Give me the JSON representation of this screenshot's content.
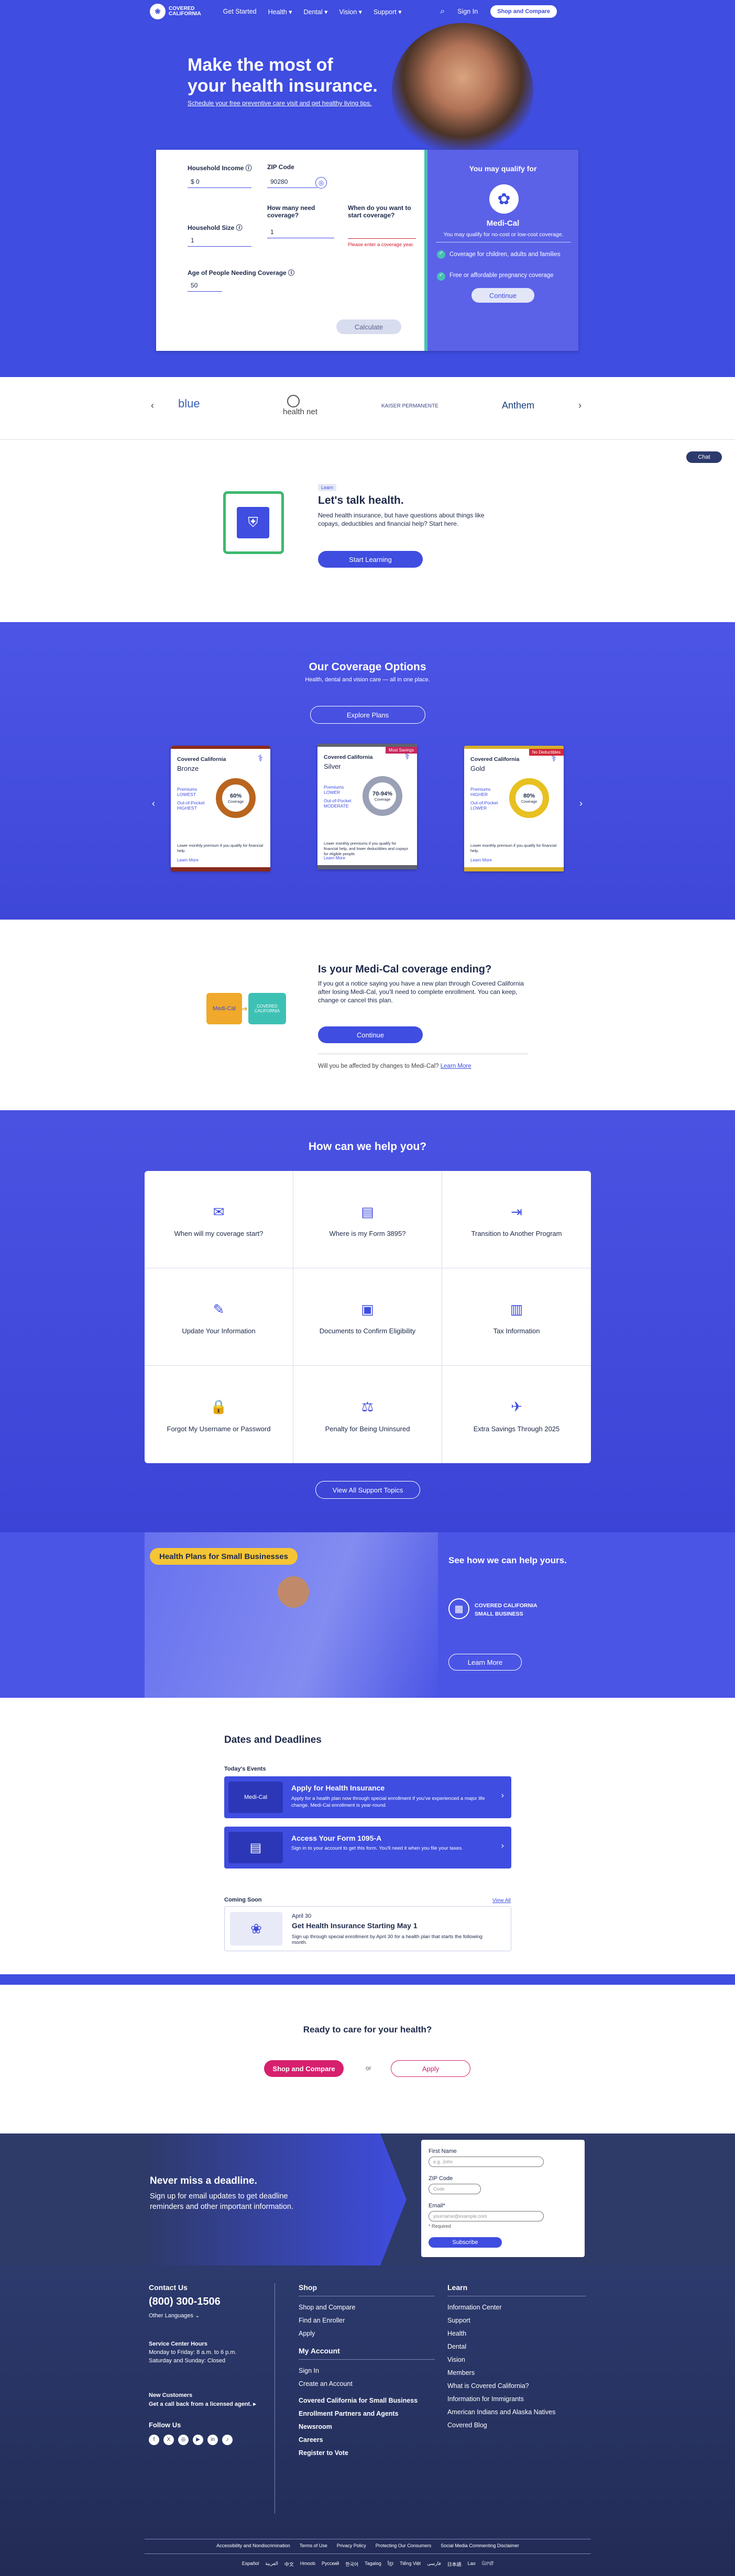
{
  "nav": {
    "logo_top": "COVERED",
    "logo_bottom": "CALIFORNIA",
    "links": [
      "Get Started",
      "Health ▾",
      "Dental ▾",
      "Vision ▾",
      "Support ▾"
    ],
    "search": "⌕",
    "signin": "Sign In",
    "shop": "Shop and Compare"
  },
  "hero": {
    "title_line1": "Make the most of",
    "title_line2": "your health insurance.",
    "subtitle": "Schedule your free preventive care visit and get healthy living tips.",
    "calc": {
      "income_label": "Household Income ⓘ",
      "income_value": "$  0",
      "zip_label": "ZIP Code",
      "zip_value": "90280",
      "size_label": "Household Size ⓘ",
      "size_value": "1",
      "how_many_label": "How many need coverage?",
      "how_many_value": "1",
      "when_label": "When do you want to start coverage?",
      "when_error": "Please enter a coverage year.",
      "age_label": "Age of People Needing Coverage ⓘ",
      "age_value": "50",
      "calculate": "Calculate"
    },
    "qualify": {
      "title": "You may qualify for",
      "program": "Medi-Cal",
      "desc": "You may qualify for no-cost or low-cost coverage.",
      "bullet1": "Coverage for children, adults and families",
      "bullet2": "Free or affordable pregnancy coverage",
      "continue": "Continue"
    }
  },
  "carriers": [
    "blue",
    "health net",
    "KAISER PERMANENTE",
    "Anthem"
  ],
  "talk": {
    "badge": "Learn",
    "title": "Let's talk health.",
    "body": "Need health insurance, but have questions about things like copays, deductibles and financial help? Start here.",
    "button": "Start Learning",
    "chat": "Chat"
  },
  "coverage": {
    "title": "Our Coverage Options",
    "subtitle": "Health, dental and vision care — all in one place.",
    "button": "Explore Plans",
    "cards": [
      {
        "brand": "Covered California",
        "tier": "Bronze",
        "pct": "60%",
        "pct_label": "Coverage",
        "premiums_label": "Premiums",
        "premiums": "LOWEST",
        "oop_label": "Out-of-Pocket",
        "oop": "HIGHEST",
        "desc": "Lower monthly premium if you qualify for financial help.",
        "more": "Learn More",
        "tag": "",
        "color": "#8a2a1b",
        "ring": "#b9651f"
      },
      {
        "brand": "Covered California",
        "tier": "Silver",
        "pct": "70-94%",
        "pct_label": "Coverage",
        "premiums_label": "Premiums",
        "premiums": "LOWER",
        "oop_label": "Out-of-Pocket",
        "oop": "MODERATE",
        "desc": "Lower monthly premiums if you qualify for financial help, and lower deductibles and copays for eligible people.",
        "more": "Learn More",
        "tag": "Most Savings",
        "color": "#5f6270",
        "ring": "#9aa0b5"
      },
      {
        "brand": "Covered California",
        "tier": "Gold",
        "pct": "80%",
        "pct_label": "Coverage",
        "premiums_label": "Premiums",
        "premiums": "HIGHER",
        "oop_label": "Out-of-Pocket",
        "oop": "LOWER",
        "desc": "Lower monthly premium if you qualify for financial help.",
        "more": "Learn More",
        "tag": "No Deductibles",
        "color": "#d7b02a",
        "ring": "#e8c020"
      }
    ]
  },
  "medical": {
    "title": "Is your Medi-Cal coverage ending?",
    "body": "If you got a notice saying you have a new plan through Covered California after losing Medi-Cal, you'll need to complete enrollment. You can keep, change or cancel this plan.",
    "button": "Continue",
    "note": "Will you be affected by changes to Medi-Cal?",
    "note_link": "Learn More",
    "tile1": "Medi-Cal",
    "tile2": "COVERED CALIFORNIA"
  },
  "help": {
    "title": "How can we help you?",
    "items": [
      {
        "label": "When will my coverage start?",
        "icon": "✉"
      },
      {
        "label": "Where is my Form 3895?",
        "icon": "▤"
      },
      {
        "label": "Transition to Another Program",
        "icon": "⇥"
      },
      {
        "label": "Update Your Information",
        "icon": "✎"
      },
      {
        "label": "Documents to Confirm Eligibility",
        "icon": "▣"
      },
      {
        "label": "Tax Information",
        "icon": "▥"
      },
      {
        "label": "Forgot My Username or Password",
        "icon": "🔒"
      },
      {
        "label": "Penalty for Being Uninsured",
        "icon": "⚖"
      },
      {
        "label": "Extra Savings Through 2025",
        "icon": "✈"
      }
    ],
    "button": "View All Support Topics"
  },
  "small_biz": {
    "banner": "Health Plans for Small Businesses",
    "title": "See how we can help yours.",
    "logo_top": "COVERED CALIFORNIA",
    "logo_bottom": "SMALL BUSINESS",
    "button": "Learn More"
  },
  "dates": {
    "title": "Dates and Deadlines",
    "today": "Today's Events",
    "events": [
      {
        "title": "Apply for Health Insurance",
        "body": "Apply for a health plan now through special enrollment if you've experienced a major life change. Medi-Cal enrollment is year-round.",
        "tag": "Medi-Cal"
      },
      {
        "title": "Access Your Form 1095-A",
        "body": "Sign in to your account to get this form. You'll need it when you file your taxes."
      }
    ],
    "coming": "Coming Soon",
    "view_all": "View All",
    "upcoming": {
      "date": "April 30",
      "title": "Get Health Insurance Starting May 1",
      "body": "Sign up through special enrollment by April 30 for a health plan that starts the following month."
    }
  },
  "ready": {
    "title": "Ready to care for your health?",
    "shop": "Shop and Compare",
    "or": "or",
    "apply": "Apply"
  },
  "newsletter": {
    "title": "Never miss a deadline.",
    "body": "Sign up for email updates to get deadline reminders and other important information.",
    "first": "First Name",
    "first_ph": "e.g. John",
    "zip": "ZIP Code",
    "zip_ph": "Code",
    "email": "Email*",
    "email_ph": "yourname@example.com",
    "required": "* Required",
    "button": "Subscribe"
  },
  "footer": {
    "contact_title": "Contact Us",
    "phone": "(800) 300-1506",
    "languages": "Other Languages ⌄",
    "hours_title": "Service Center Hours",
    "hours1": "Monday to Friday: 8 a.m. to 6 p.m.",
    "hours2": "Saturday and Sunday: Closed",
    "new_title": "New Customers",
    "new_body": "Get a call back from a licensed agent. ▸",
    "follow": "Follow Us",
    "shop_title": "Shop",
    "shop_links": [
      "Shop and Compare",
      "Find an Enroller",
      "Apply"
    ],
    "account_title": "My Account",
    "account_links": [
      "Sign In",
      "Create an Account"
    ],
    "extra_links": [
      "Covered California for Small Business",
      "Enrollment Partners and Agents",
      "Newsroom",
      "Careers",
      "Register to Vote"
    ],
    "learn_title": "Learn",
    "learn_links": [
      "Information Center",
      "Support",
      "Health",
      "Dental",
      "Vision",
      "Members",
      "What is Covered California?",
      "Information for Immigrants",
      "American Indians and Alaska Natives",
      "Covered Blog"
    ],
    "legal": [
      "Accessibility and Nondiscrimination",
      "Terms of Use",
      "Privacy Policy",
      "Protecting Our Consumers",
      "Social Media Commenting Disclaimer"
    ],
    "langs": [
      "Español",
      "العربية",
      "中文",
      "Hmoob",
      "Русский",
      "한국어",
      "Tagalog",
      "ខ្មែរ",
      "Tiếng Việt",
      "فارسی",
      "日本語",
      "Lao",
      "ਪੰਜਾਬੀ"
    ]
  }
}
